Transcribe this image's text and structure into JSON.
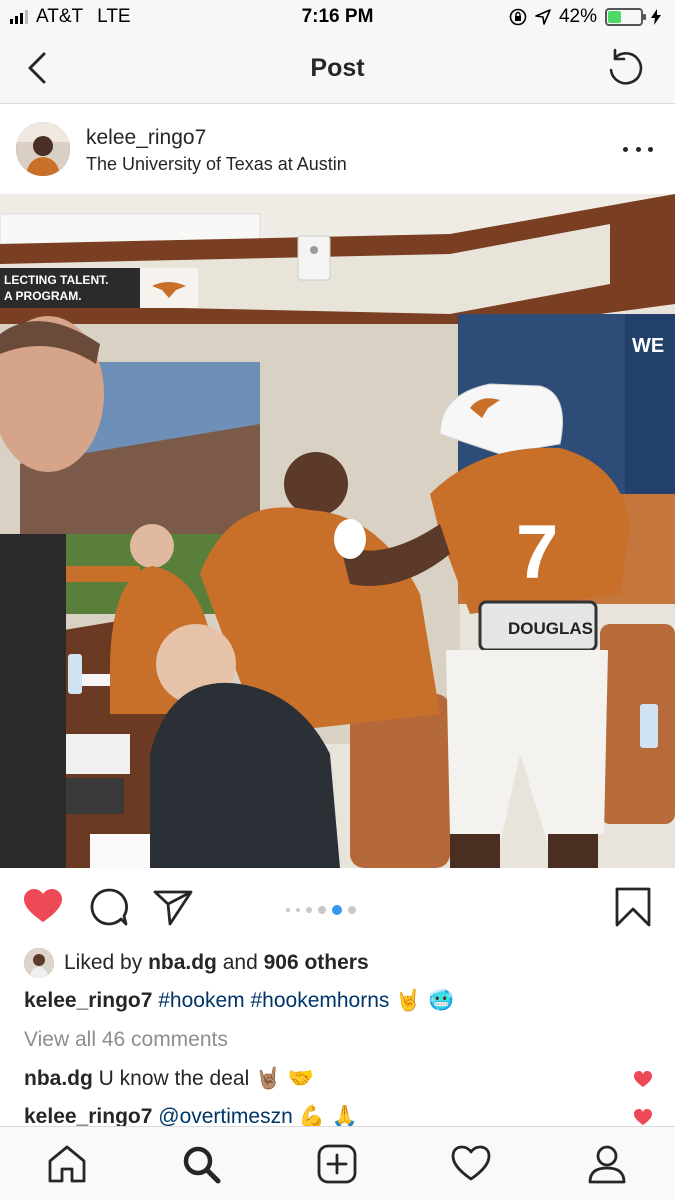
{
  "status_bar": {
    "carrier": "AT&T",
    "network": "LTE",
    "time": "7:16 PM",
    "battery_percent_label": "42%",
    "battery_level": 0.42,
    "icons": [
      "signal-icon",
      "lock-rotation-icon",
      "location-arrow-icon",
      "battery-icon",
      "charging-bolt-icon"
    ]
  },
  "nav": {
    "title": "Post",
    "back_icon": "chevron-left-icon",
    "refresh_icon": "refresh-icon"
  },
  "post": {
    "username": "kelee_ringo7",
    "location": "The University of Texas at Austin",
    "photo_text": {
      "banner": "LECTING TALENT.",
      "banner_line2": "A PROGRAM.",
      "wall_text": "WE",
      "jersey_number": "7",
      "belt_name": "DOUGLAS"
    },
    "carousel": {
      "count": 6,
      "active_index": 4
    },
    "liked_by_prefix": "Liked by ",
    "liked_by_user": "nba.dg",
    "liked_by_middle": " and ",
    "liked_by_others": "906 others",
    "caption": {
      "username": "kelee_ringo7",
      "hashtag1": "#hookem",
      "hashtag2": "#hookemhorns",
      "emojis": "🤘 🥶"
    },
    "view_comments": "View all 46 comments",
    "comments": [
      {
        "username": "nba.dg",
        "text": " U know the deal",
        "emojis": "🤘🏽 🤝"
      },
      {
        "username": "kelee_ringo7",
        "mention": "@overtimeszn",
        "emojis": "💪 🙏"
      }
    ]
  },
  "colors": {
    "like_red": "#ed4956",
    "active_dot": "#3897f0",
    "texas_orange": "#c8702a",
    "link_blue": "#003569"
  },
  "tab_bar": [
    "home-icon",
    "search-icon",
    "new-post-icon",
    "activity-heart-icon",
    "profile-icon"
  ]
}
